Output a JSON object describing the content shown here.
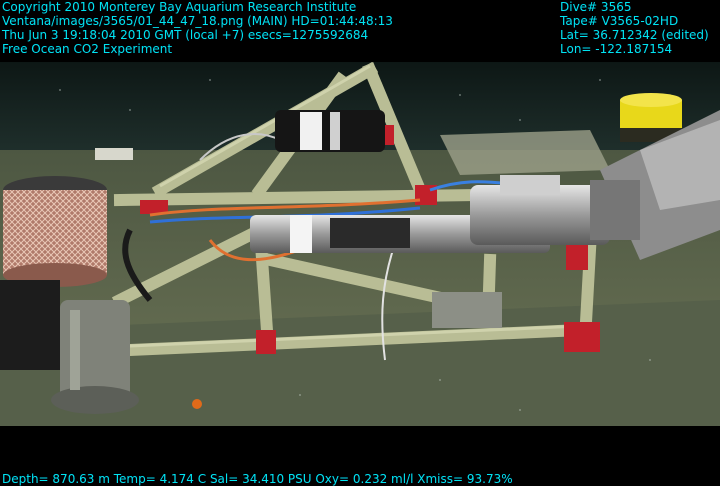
{
  "overlay": {
    "top_left": [
      "Copyright 2010 Monterey Bay Aquarium Research Institute",
      "Ventana/images/3565/01_44_47_18.png (MAIN)  HD=01:44:48:13",
      "Thu Jun  3 19:18:04 2010 GMT (local +7)  esecs=1275592684",
      "Free Ocean CO2 Experiment"
    ],
    "top_right": [
      "Dive# 3565",
      "Tape# V3565-02HD",
      "Lat= 36.712342 (edited)",
      "Lon= -122.187154"
    ],
    "bottom": "Depth= 870.63 m  Temp= 4.174 C  Sal= 34.410 PSU  Oxy= 0.232 ml/l  Xmiss= 93.73%"
  },
  "colors": {
    "overlay_text": "#00e5ee",
    "seawater": "#1d2f2c",
    "seafloor": "#5f6a4e",
    "frame_struts": "#b9bd95",
    "red_brackets": "#c2202a",
    "yellow_float": "#e8d81a"
  }
}
